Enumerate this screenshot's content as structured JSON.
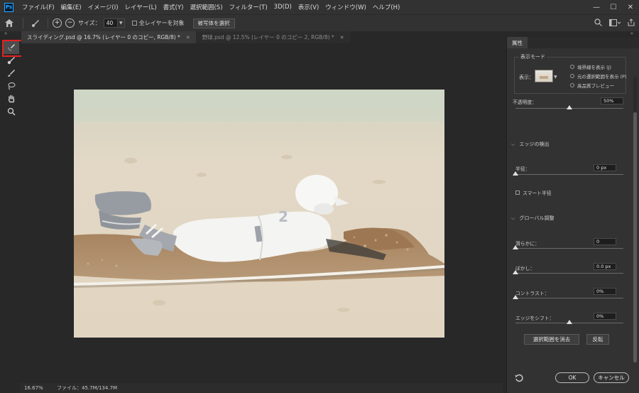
{
  "menu": {
    "logo": "Ps",
    "items": [
      "ファイル(F)",
      "編集(E)",
      "イメージ(I)",
      "レイヤー(L)",
      "書式(Y)",
      "選択範囲(S)",
      "フィルター(T)",
      "3D(D)",
      "表示(V)",
      "ウィンドウ(W)",
      "ヘルプ(H)"
    ],
    "window_controls": [
      "—",
      "☐",
      "✕"
    ]
  },
  "options": {
    "size_label": "サイズ：",
    "size_value": "40",
    "sample_all_layers_label": "全レイヤーを対象",
    "select_subject_label": "被写体を選択"
  },
  "tabs": [
    {
      "label": "スライディング.psd @ 16.7% (レイヤー 0 のコピー, RGB/8) *",
      "active": true
    },
    {
      "label": "野球.psd @ 12.5% (レイヤー 0 のコピー 2, RGB/8) *",
      "active": false
    }
  ],
  "status": {
    "zoom": "16.67%",
    "file": "ファイル：45.7M/134.7M"
  },
  "properties": {
    "tab_label": "属性",
    "view_mode": {
      "title": "表示モード",
      "view_label": "表示：",
      "options": [
        "境界線を表示 (J)",
        "元の選択範囲を表示 (P)",
        "高品質プレビュー"
      ]
    },
    "opacity": {
      "label": "不透明度：",
      "value": "50%",
      "fraction": 0.5
    },
    "edge_detection": {
      "title": "エッジの検出",
      "radius_label": "半径：",
      "radius_value": "0 px",
      "smart_radius_label": "スマート半径"
    },
    "global": {
      "title": "グローバル調整",
      "smooth_label": "滑らかに：",
      "smooth_value": "0",
      "feather_label": "ぼかし：",
      "feather_value": "0.0 px",
      "contrast_label": "コントラスト：",
      "contrast_value": "0%",
      "shift_label": "エッジをシフト：",
      "shift_value": "0%"
    },
    "clear_selection_label": "選択範囲を消去",
    "invert_label": "反転",
    "ok_label": "OK",
    "cancel_label": "キャンセル"
  },
  "colors": {
    "accent": "#31a8ff",
    "highlight": "#e62020"
  }
}
